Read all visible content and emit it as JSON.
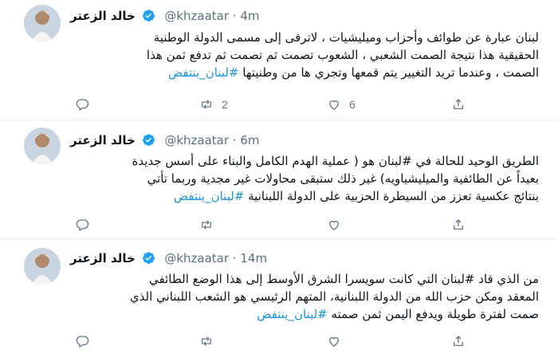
{
  "tweets": [
    {
      "author": "خالد الزعتر",
      "handle": "@khzaatar",
      "sep": "·",
      "time": "4m",
      "lines": [
        {
          "text": "لبنان عبارة عن طوائف وأحزاب وميليشيات ، لاترقى إلى مسمى الدولة الوطنية",
          "link": ""
        },
        {
          "text": "الحقيقية  هذا نتيجة الصمت الشعبي ، الشعوب تصمت ثم تصمت ثم تدفع ثمن هذا",
          "link": ""
        },
        {
          "text": "الصمت ، وعندما تريد التغيير يتم قمعها وتجري ها من وطنيتها ",
          "link": "#لبنان_ينتفض"
        }
      ],
      "retweets": "2",
      "likes": "6"
    },
    {
      "author": "خالد الزعتر",
      "handle": "@khzaatar",
      "sep": "·",
      "time": "6m",
      "lines": [
        {
          "text": "الطريق الوحيد للحالة في #لبنان هو ( عملية الهدم الكامل والبناء على أسس جديدة",
          "link": ""
        },
        {
          "text": "بعيداً عن الطائفية والميليشياويه) غير ذلك ستبقى محاولات غير مجدية وربما تأتي",
          "link": ""
        },
        {
          "text": "بنتائج عكسية تعزز من السيطرة الحزبية على الدولة اللبنانية ",
          "link": "#لبنان_ينتفض"
        }
      ],
      "retweets": "",
      "likes": ""
    },
    {
      "author": "خالد الزعتر",
      "handle": "@khzaatar",
      "sep": "·",
      "time": "14m",
      "lines": [
        {
          "text": "من الذي قاد #لبنان التي كانت سويسرا الشرق الأوسط إلى هذا الوضع الطائفي",
          "link": ""
        },
        {
          "text": "المعقد ومكن حزب الله من الدولة اللبنانية، المتهم الرئيسي هو الشعب اللبناني الذي",
          "link": ""
        },
        {
          "text": "صمت لفترة طويلة ويدفع اليمن ثمن صمته ",
          "link": "#لبنان_ينتفض"
        }
      ],
      "retweets": "",
      "likes": ""
    }
  ],
  "colors": {
    "accent": "#1b95e0",
    "muted": "#657786",
    "text": "#0f1419",
    "verified": "#1da1f2"
  },
  "icons": [
    "reply-icon",
    "retweet-icon",
    "like-icon",
    "share-icon",
    "verified-badge-icon"
  ]
}
